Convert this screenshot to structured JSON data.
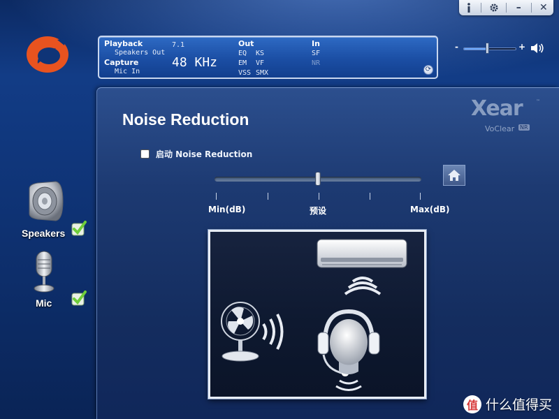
{
  "window_controls": {
    "info_icon": "info-icon",
    "settings_icon": "gear-icon",
    "minimize_label": "–",
    "close_label": "✕"
  },
  "status": {
    "playback_label": "Playback",
    "playback_device": "Speakers Out",
    "capture_label": "Capture",
    "capture_device": "Mic In",
    "channels": "7.1",
    "sample_rate": "48 KHz",
    "out_label": "Out",
    "out_effects": [
      "EQ",
      "KS",
      "EM",
      "VF",
      "VSS",
      "SMX"
    ],
    "in_label": "In",
    "in_effects_active": "SF",
    "in_effects_inactive": "NR"
  },
  "master_volume": {
    "minus": "-",
    "plus": "+",
    "level": 0.45
  },
  "devices": [
    {
      "label": "Speakers",
      "checked": true
    },
    {
      "label": "Mic",
      "checked": true
    }
  ],
  "panel": {
    "title": "Noise Reduction",
    "brand": "Xear",
    "brand_sub": "VoClear",
    "brand_badge": "NR",
    "enable_label": "启动 Noise Reduction",
    "enabled": false,
    "slider_level": 0.5,
    "min_label": "Min(dB)",
    "preset_label": "预设",
    "max_label": "Max(dB)"
  },
  "watermark": {
    "text": "什么值得买",
    "icon_text": "值"
  },
  "colors": {
    "background": "#0f3477",
    "accent": "#6aa8ff",
    "logo": "#e8531f",
    "check": "#6fce3a"
  }
}
